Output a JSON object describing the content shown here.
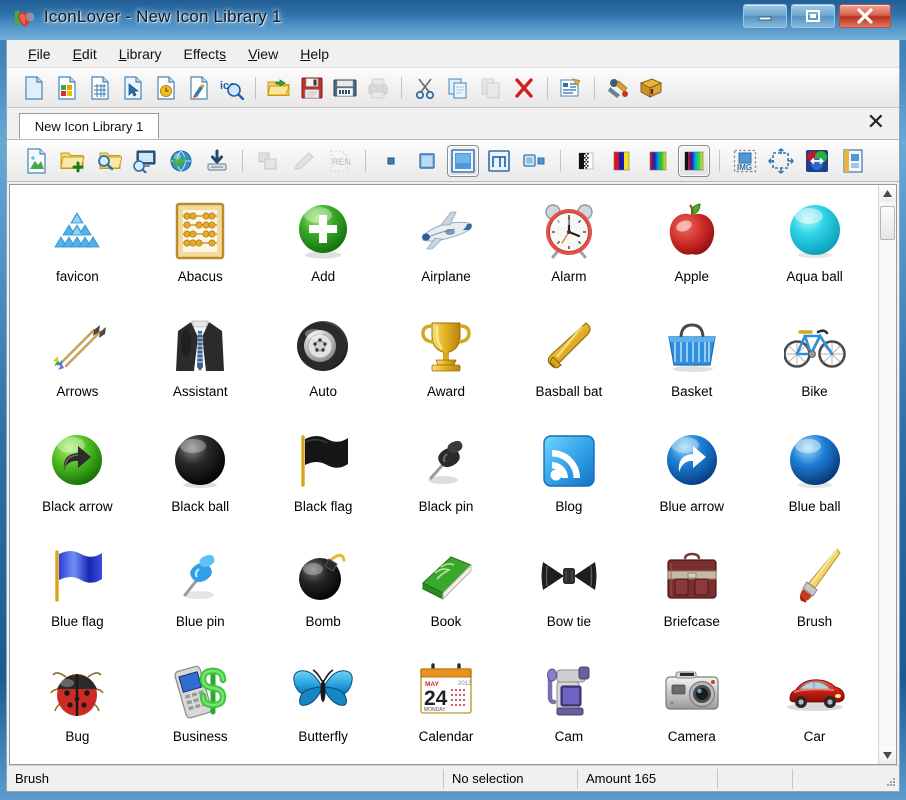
{
  "window": {
    "title": "IconLover - New Icon Library 1",
    "app_icon": "heart-icon",
    "controls": {
      "minimize": "minimize-icon",
      "maximize": "maximize-icon",
      "close": "close-icon"
    }
  },
  "menu": {
    "items": [
      {
        "label": "File",
        "accel": "F"
      },
      {
        "label": "Edit",
        "accel": "E"
      },
      {
        "label": "Library",
        "accel": "L"
      },
      {
        "label": "Effects",
        "accel": "s"
      },
      {
        "label": "View",
        "accel": "V"
      },
      {
        "label": "Help",
        "accel": "H"
      }
    ]
  },
  "toolbar_main": {
    "buttons": [
      {
        "name": "new-image-icon",
        "enabled": true
      },
      {
        "name": "new-color-image-icon",
        "enabled": true
      },
      {
        "name": "new-grid-image-icon",
        "enabled": true
      },
      {
        "name": "new-cursor-icon",
        "enabled": true
      },
      {
        "name": "new-clock-image-icon",
        "enabled": true
      },
      {
        "name": "new-paint-image-icon",
        "enabled": true
      },
      {
        "name": "ico-search-icon",
        "enabled": true
      },
      {
        "name": "separator",
        "enabled": true
      },
      {
        "name": "open-folder-icon",
        "enabled": true
      },
      {
        "name": "save-icon",
        "enabled": true
      },
      {
        "name": "save-all-icon",
        "enabled": true
      },
      {
        "name": "print-icon",
        "enabled": false
      },
      {
        "name": "separator",
        "enabled": true
      },
      {
        "name": "cut-icon",
        "enabled": true
      },
      {
        "name": "copy-icon",
        "enabled": true
      },
      {
        "name": "paste-icon",
        "enabled": false
      },
      {
        "name": "delete-icon",
        "enabled": true
      },
      {
        "name": "separator",
        "enabled": true
      },
      {
        "name": "properties-icon",
        "enabled": true
      },
      {
        "name": "separator",
        "enabled": true
      },
      {
        "name": "capture-icon",
        "enabled": true
      },
      {
        "name": "help-book-icon",
        "enabled": true
      }
    ]
  },
  "tabs": {
    "active": "New Icon Library 1",
    "close_label": "✕"
  },
  "toolbar_library": {
    "buttons": [
      {
        "name": "add-image-icon",
        "state": "normal"
      },
      {
        "name": "add-folder-icon",
        "state": "normal"
      },
      {
        "name": "find-folder-icon",
        "state": "normal"
      },
      {
        "name": "import-screen-icon",
        "state": "normal"
      },
      {
        "name": "globe-icon",
        "state": "normal"
      },
      {
        "name": "export-download-icon",
        "state": "normal"
      },
      {
        "name": "separator",
        "state": "normal"
      },
      {
        "name": "arrange-icon",
        "state": "disabled"
      },
      {
        "name": "edit-pencil-icon",
        "state": "disabled"
      },
      {
        "name": "rename-icon",
        "state": "disabled"
      },
      {
        "name": "separator",
        "state": "normal"
      },
      {
        "name": "size-tiny-icon",
        "state": "normal"
      },
      {
        "name": "size-small-icon",
        "state": "normal"
      },
      {
        "name": "size-large-icon",
        "state": "checked"
      },
      {
        "name": "size-xlarge-icon",
        "state": "normal"
      },
      {
        "name": "size-list-icon",
        "state": "normal"
      },
      {
        "name": "separator",
        "state": "normal"
      },
      {
        "name": "depth-monochrome-icon",
        "state": "normal"
      },
      {
        "name": "depth-16-colors-icon",
        "state": "normal"
      },
      {
        "name": "depth-256-colors-icon",
        "state": "normal"
      },
      {
        "name": "depth-truecolor-icon",
        "state": "checked"
      },
      {
        "name": "separator",
        "state": "normal"
      },
      {
        "name": "image-format-icon",
        "state": "normal"
      },
      {
        "name": "resize-icon",
        "state": "normal"
      },
      {
        "name": "color-adjust-icon",
        "state": "normal"
      },
      {
        "name": "effects-icon",
        "state": "normal"
      }
    ]
  },
  "library": {
    "columns": 7,
    "icons": [
      {
        "label": "favicon",
        "art": "favicon-art"
      },
      {
        "label": "Abacus",
        "art": "abacus-art"
      },
      {
        "label": "Add",
        "art": "add-art"
      },
      {
        "label": "Airplane",
        "art": "airplane-art"
      },
      {
        "label": "Alarm",
        "art": "alarm-art"
      },
      {
        "label": "Apple",
        "art": "apple-art"
      },
      {
        "label": "Aqua ball",
        "art": "aqua-ball-art"
      },
      {
        "label": "Arrows",
        "art": "arrows-art"
      },
      {
        "label": "Assistant",
        "art": "assistant-art"
      },
      {
        "label": "Auto",
        "art": "auto-art"
      },
      {
        "label": "Award",
        "art": "award-art"
      },
      {
        "label": "Basball bat",
        "art": "baseball-bat-art"
      },
      {
        "label": "Basket",
        "art": "basket-art"
      },
      {
        "label": "Bike",
        "art": "bike-art"
      },
      {
        "label": "Black arrow",
        "art": "black-arrow-art"
      },
      {
        "label": "Black ball",
        "art": "black-ball-art"
      },
      {
        "label": "Black flag",
        "art": "black-flag-art"
      },
      {
        "label": "Black pin",
        "art": "black-pin-art"
      },
      {
        "label": "Blog",
        "art": "blog-art"
      },
      {
        "label": "Blue arrow",
        "art": "blue-arrow-art"
      },
      {
        "label": "Blue ball",
        "art": "blue-ball-art"
      },
      {
        "label": "Blue flag",
        "art": "blue-flag-art"
      },
      {
        "label": "Blue pin",
        "art": "blue-pin-art"
      },
      {
        "label": "Bomb",
        "art": "bomb-art"
      },
      {
        "label": "Book",
        "art": "book-art"
      },
      {
        "label": "Bow tie",
        "art": "bow-tie-art"
      },
      {
        "label": "Briefcase",
        "art": "briefcase-art"
      },
      {
        "label": "Brush",
        "art": "brush-art"
      },
      {
        "label": "Bug",
        "art": "bug-art"
      },
      {
        "label": "Business",
        "art": "business-art"
      },
      {
        "label": "Butterfly",
        "art": "butterfly-art"
      },
      {
        "label": "Calendar",
        "art": "calendar-art"
      },
      {
        "label": "Cam",
        "art": "cam-art"
      },
      {
        "label": "Camera",
        "art": "camera-art"
      },
      {
        "label": "Car",
        "art": "car-art"
      }
    ],
    "calendar_detail": {
      "month": "MAY",
      "day": "24",
      "weekday": "MONDAY",
      "year": "2013"
    }
  },
  "statusbar": {
    "tool": "Brush",
    "selection": "No selection",
    "amount": "Amount 165",
    "field4": "",
    "field5": ""
  },
  "colors": {
    "title_gradient_top": "#1e5b93",
    "title_gradient_bottom": "#79b2da",
    "close_button": "#b8301c",
    "client_bg": "#f0f0f0",
    "grid_bg": "#ffffff",
    "accent_blue": "#2f6ea8"
  }
}
